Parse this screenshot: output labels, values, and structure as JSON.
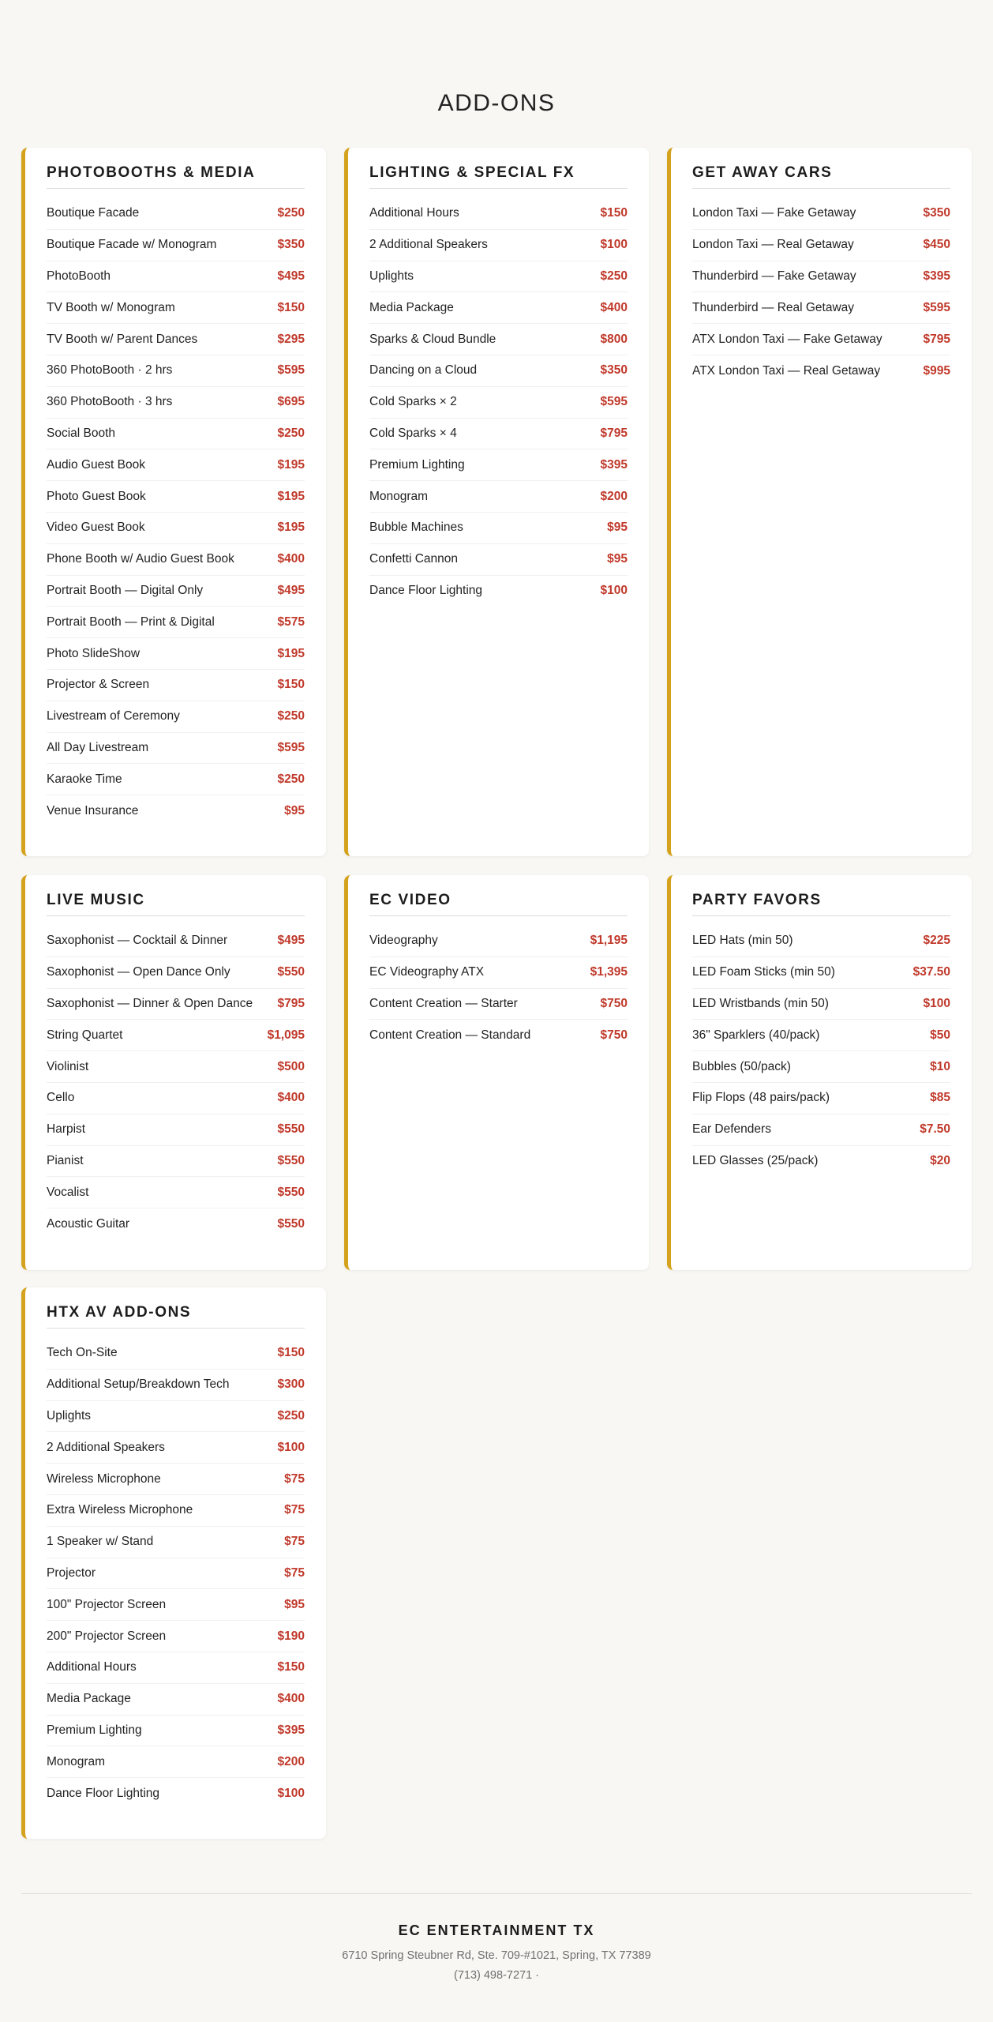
{
  "page": {
    "title": "ADD-ONS"
  },
  "sections": {
    "photobooths": {
      "title": "PHOTOBOOTHS & MEDIA",
      "items": [
        {
          "name": "Boutique Facade",
          "price": "$250"
        },
        {
          "name": "Boutique Facade w/ Monogram",
          "price": "$350"
        },
        {
          "name": "PhotoBooth",
          "price": "$495"
        },
        {
          "name": "TV Booth w/ Monogram",
          "price": "$150"
        },
        {
          "name": "TV Booth w/ Parent Dances",
          "price": "$295"
        },
        {
          "name": "360 PhotoBooth · 2 hrs",
          "price": "$595"
        },
        {
          "name": "360 PhotoBooth · 3 hrs",
          "price": "$695"
        },
        {
          "name": "Social Booth",
          "price": "$250"
        },
        {
          "name": "Audio Guest Book",
          "price": "$195"
        },
        {
          "name": "Photo Guest Book",
          "price": "$195"
        },
        {
          "name": "Video Guest Book",
          "price": "$195"
        },
        {
          "name": "Phone Booth w/ Audio Guest Book",
          "price": "$400"
        },
        {
          "name": "Portrait Booth — Digital Only",
          "price": "$495"
        },
        {
          "name": "Portrait Booth — Print & Digital",
          "price": "$575"
        },
        {
          "name": "Photo SlideShow",
          "price": "$195"
        },
        {
          "name": "Projector & Screen",
          "price": "$150"
        },
        {
          "name": "Livestream of Ceremony",
          "price": "$250"
        },
        {
          "name": "All Day Livestream",
          "price": "$595"
        },
        {
          "name": "Karaoke Time",
          "price": "$250"
        },
        {
          "name": "Venue Insurance",
          "price": "$95"
        }
      ]
    },
    "lighting": {
      "title": "LIGHTING & SPECIAL FX",
      "items": [
        {
          "name": "Additional Hours",
          "price": "$150"
        },
        {
          "name": "2 Additional Speakers",
          "price": "$100"
        },
        {
          "name": "Uplights",
          "price": "$250"
        },
        {
          "name": "Media Package",
          "price": "$400"
        },
        {
          "name": "Sparks & Cloud Bundle",
          "price": "$800"
        },
        {
          "name": "Dancing on a Cloud",
          "price": "$350"
        },
        {
          "name": "Cold Sparks × 2",
          "price": "$595"
        },
        {
          "name": "Cold Sparks × 4",
          "price": "$795"
        },
        {
          "name": "Premium Lighting",
          "price": "$395"
        },
        {
          "name": "Monogram",
          "price": "$200"
        },
        {
          "name": "Bubble Machines",
          "price": "$95"
        },
        {
          "name": "Confetti Cannon",
          "price": "$95"
        },
        {
          "name": "Dance Floor Lighting",
          "price": "$100"
        }
      ]
    },
    "cars": {
      "title": "GET AWAY CARS",
      "items": [
        {
          "name": "London Taxi — Fake Getaway",
          "price": "$350"
        },
        {
          "name": "London Taxi — Real Getaway",
          "price": "$450"
        },
        {
          "name": "Thunderbird — Fake Getaway",
          "price": "$395"
        },
        {
          "name": "Thunderbird — Real Getaway",
          "price": "$595"
        },
        {
          "name": "ATX London Taxi — Fake Getaway",
          "price": "$795"
        },
        {
          "name": "ATX London Taxi — Real Getaway",
          "price": "$995"
        }
      ]
    },
    "music": {
      "title": "LIVE MUSIC",
      "items": [
        {
          "name": "Saxophonist — Cocktail & Dinner",
          "price": "$495"
        },
        {
          "name": "Saxophonist — Open Dance Only",
          "price": "$550"
        },
        {
          "name": "Saxophonist — Dinner & Open Dance",
          "price": "$795"
        },
        {
          "name": "String Quartet",
          "price": "$1,095"
        },
        {
          "name": "Violinist",
          "price": "$500"
        },
        {
          "name": "Cello",
          "price": "$400"
        },
        {
          "name": "Harpist",
          "price": "$550"
        },
        {
          "name": "Pianist",
          "price": "$550"
        },
        {
          "name": "Vocalist",
          "price": "$550"
        },
        {
          "name": "Acoustic Guitar",
          "price": "$550"
        }
      ]
    },
    "video": {
      "title": "EC VIDEO",
      "items": [
        {
          "name": "Videography",
          "price": "$1,195"
        },
        {
          "name": "EC Videography ATX",
          "price": "$1,395"
        },
        {
          "name": "Content Creation — Starter",
          "price": "$750"
        },
        {
          "name": "Content Creation — Standard",
          "price": "$750"
        }
      ]
    },
    "favors": {
      "title": "PARTY FAVORS",
      "items": [
        {
          "name": "LED Hats (min 50)",
          "price": "$225"
        },
        {
          "name": "LED Foam Sticks (min 50)",
          "price": "$37.50"
        },
        {
          "name": "LED Wristbands (min 50)",
          "price": "$100"
        },
        {
          "name": "36\" Sparklers (40/pack)",
          "price": "$50"
        },
        {
          "name": "Bubbles (50/pack)",
          "price": "$10"
        },
        {
          "name": "Flip Flops (48 pairs/pack)",
          "price": "$85"
        },
        {
          "name": "Ear Defenders",
          "price": "$7.50"
        },
        {
          "name": "LED Glasses (25/pack)",
          "price": "$20"
        }
      ]
    },
    "htx": {
      "title": "HTX AV ADD-ONS",
      "items": [
        {
          "name": "Tech On-Site",
          "price": "$150"
        },
        {
          "name": "Additional Setup/Breakdown Tech",
          "price": "$300"
        },
        {
          "name": "Uplights",
          "price": "$250"
        },
        {
          "name": "2 Additional Speakers",
          "price": "$100"
        },
        {
          "name": "Wireless Microphone",
          "price": "$75"
        },
        {
          "name": "Extra Wireless Microphone",
          "price": "$75"
        },
        {
          "name": "1 Speaker w/ Stand",
          "price": "$75"
        },
        {
          "name": "Projector",
          "price": "$75"
        },
        {
          "name": "100\" Projector Screen",
          "price": "$95"
        },
        {
          "name": "200\" Projector Screen",
          "price": "$190"
        },
        {
          "name": "Additional Hours",
          "price": "$150"
        },
        {
          "name": "Media Package",
          "price": "$400"
        },
        {
          "name": "Premium Lighting",
          "price": "$395"
        },
        {
          "name": "Monogram",
          "price": "$200"
        },
        {
          "name": "Dance Floor Lighting",
          "price": "$100"
        }
      ]
    }
  },
  "footer": {
    "company": "EC ENTERTAINMENT TX",
    "address": "6710 Spring Steubner Rd, Ste. 709-#1021, Spring, TX 77389",
    "phone": "(713) 498-7271 ·"
  },
  "colors": {
    "accent": "#d4a21c",
    "price": "#c0392b",
    "background": "#f8f7f4"
  }
}
